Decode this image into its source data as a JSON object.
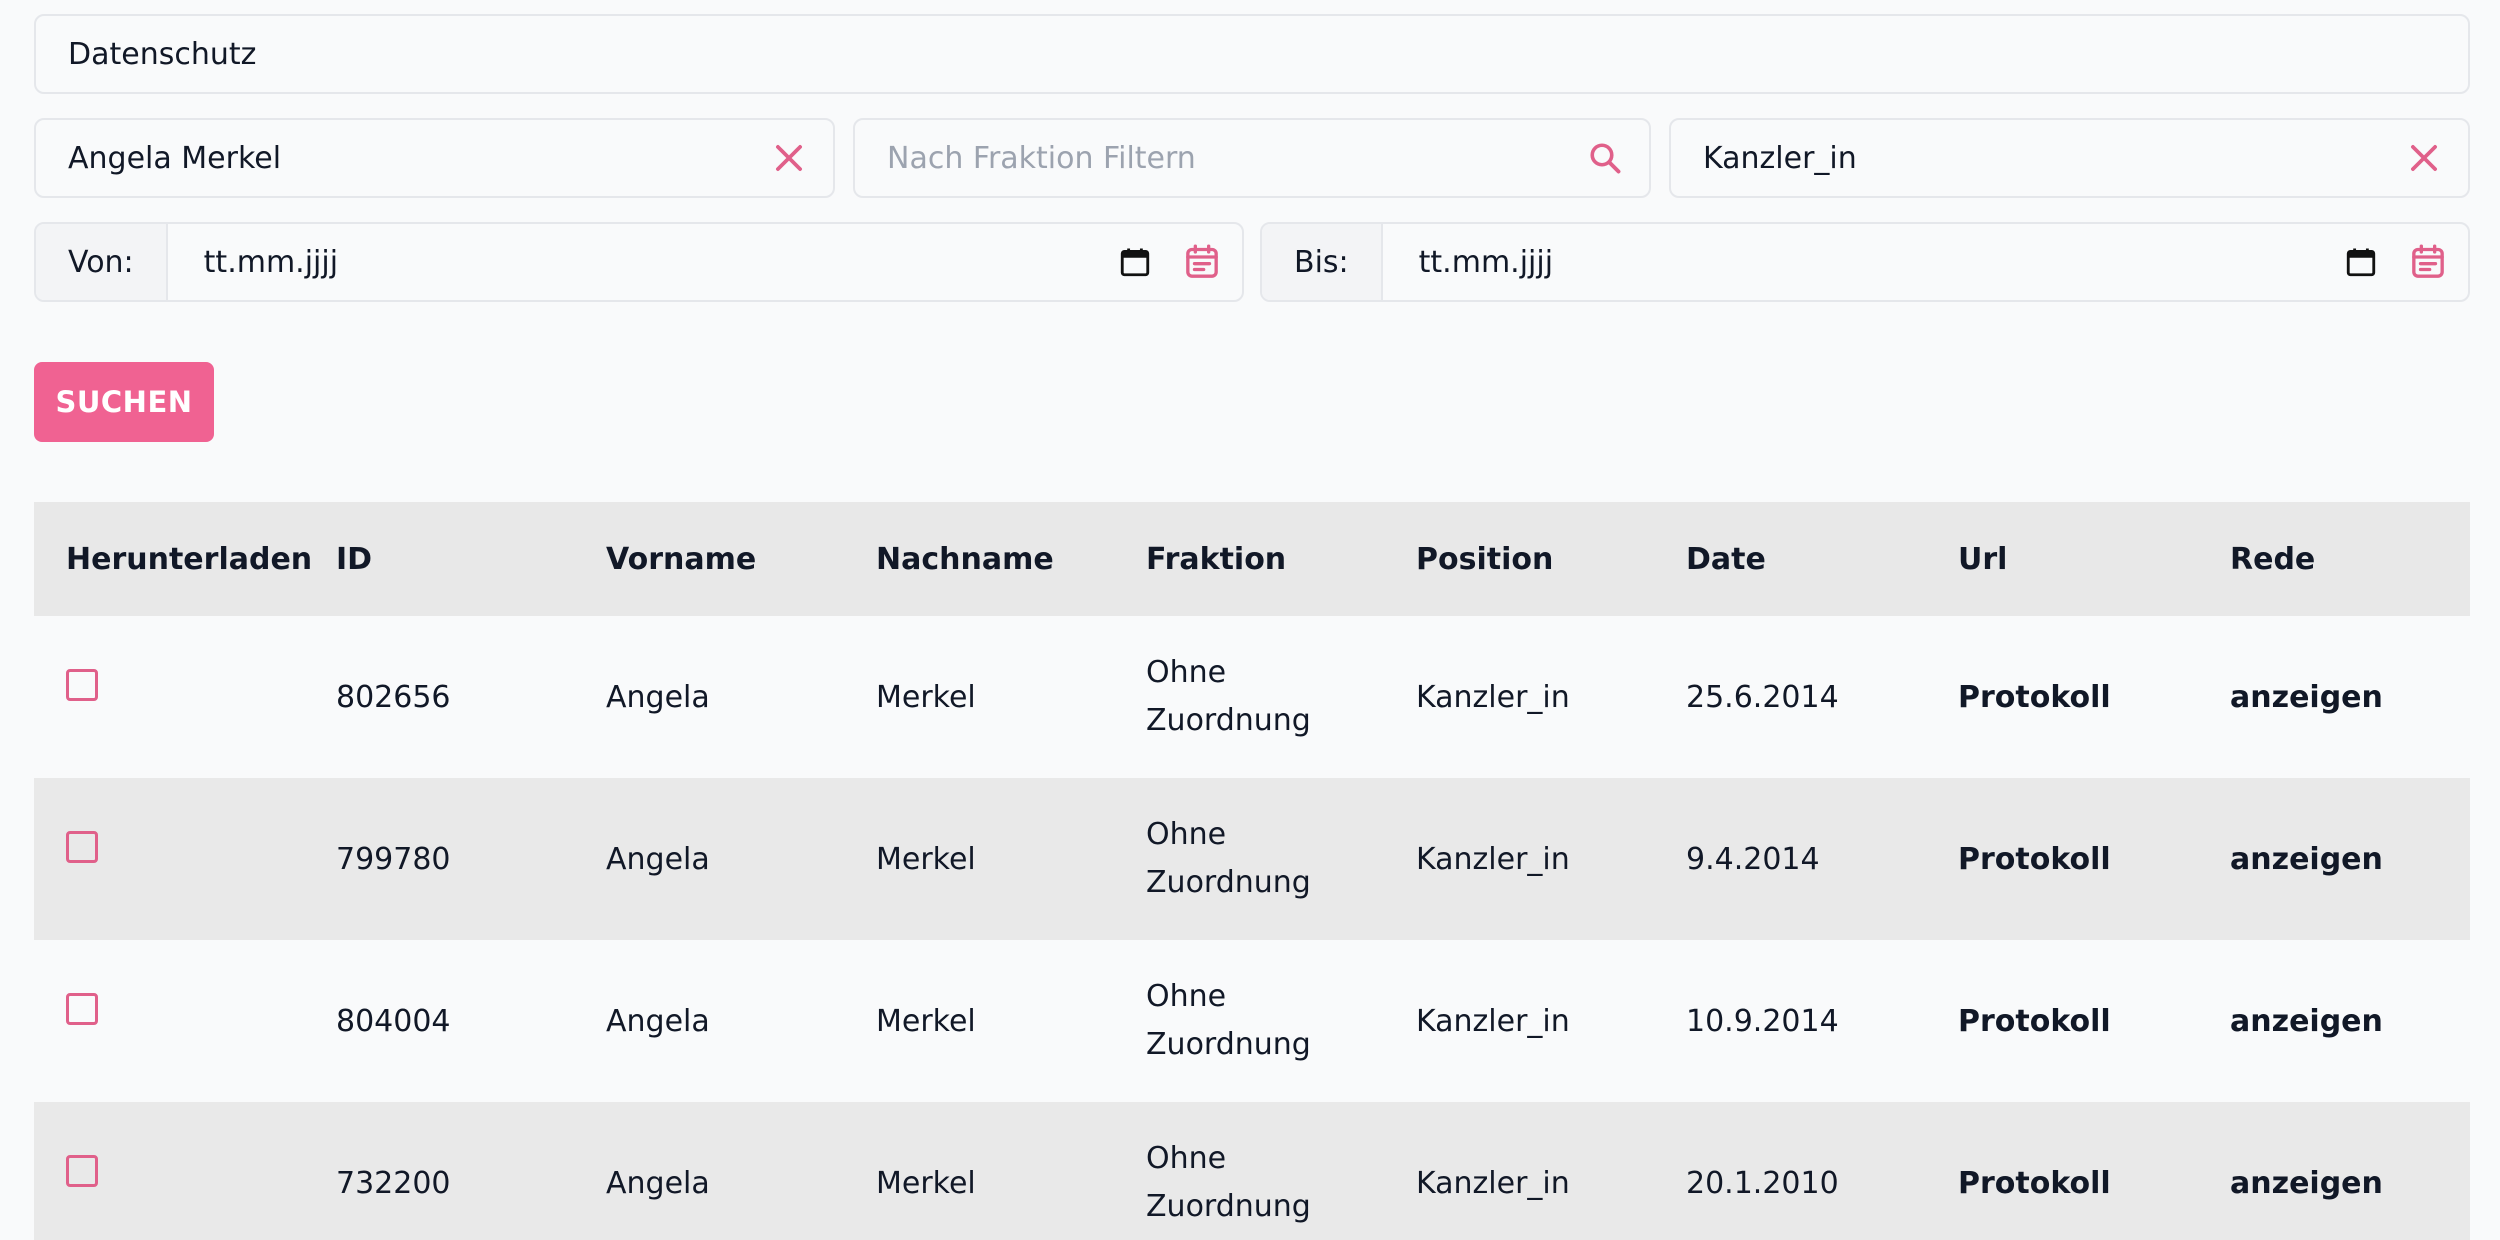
{
  "search": {
    "value": "Datenschutz"
  },
  "filters": {
    "person": {
      "value": "Angela Merkel"
    },
    "fraktion": {
      "placeholder": "Nach Fraktion Filtern"
    },
    "position": {
      "value": "Kanzler_in"
    }
  },
  "dates": {
    "from": {
      "label": "Von:",
      "value": "tt.mm.jjjj"
    },
    "to": {
      "label": "Bis:",
      "value": "tt.mm.jjjj"
    }
  },
  "search_button": {
    "label": "SUCHEN"
  },
  "table": {
    "headers": [
      "Herunterladen",
      "ID",
      "Vorname",
      "Nachname",
      "Fraktion",
      "Position",
      "Date",
      "Url",
      "Rede"
    ],
    "rows": [
      {
        "id": "802656",
        "vorname": "Angela",
        "nachname": "Merkel",
        "fraktion_1": "Ohne",
        "fraktion_2": "Zuordnung",
        "position": "Kanzler_in",
        "date": "25.6.2014",
        "url": "Protokoll",
        "rede": "anzeigen"
      },
      {
        "id": "799780",
        "vorname": "Angela",
        "nachname": "Merkel",
        "fraktion_1": "Ohne",
        "fraktion_2": "Zuordnung",
        "position": "Kanzler_in",
        "date": "9.4.2014",
        "url": "Protokoll",
        "rede": "anzeigen"
      },
      {
        "id": "804004",
        "vorname": "Angela",
        "nachname": "Merkel",
        "fraktion_1": "Ohne",
        "fraktion_2": "Zuordnung",
        "position": "Kanzler_in",
        "date": "10.9.2014",
        "url": "Protokoll",
        "rede": "anzeigen"
      },
      {
        "id": "732200",
        "vorname": "Angela",
        "nachname": "Merkel",
        "fraktion_1": "Ohne",
        "fraktion_2": "Zuordnung",
        "position": "Kanzler_in",
        "date": "20.1.2010",
        "url": "Protokoll",
        "rede": "anzeigen"
      }
    ]
  },
  "colors": {
    "accent": "#f06292",
    "icon_pink": "#e0608a",
    "header_bg": "#e8e8e8",
    "row_alt_bg": "#e9e9e9"
  },
  "icons": [
    "close-icon",
    "search-icon",
    "calendar-icon",
    "calendar-event-icon"
  ]
}
